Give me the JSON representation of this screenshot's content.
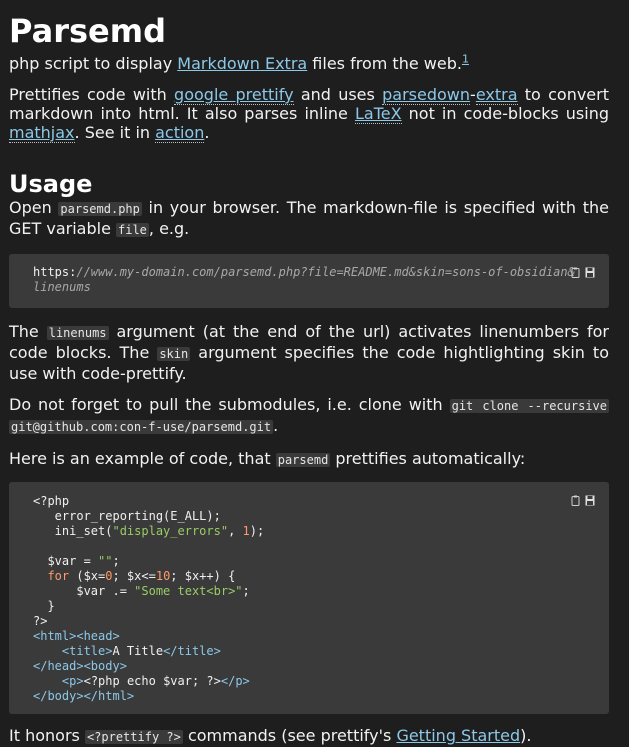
{
  "title": "Parsemd",
  "tagline": {
    "before": "php script to display ",
    "link": "Markdown Extra",
    "after": " files from the web.",
    "footnote": "1"
  },
  "pretty": {
    "t1": "Prettifies code with ",
    "l1": "google prettify",
    "t2": " and uses ",
    "l2": "parsedown",
    "dash": "-",
    "l3": "extra",
    "t3": " to convert markdown into html. It also parses inline ",
    "l4": "LaTeX",
    "t4": " not in code-blocks using ",
    "l5": "mathjax",
    "t5": ". See it in ",
    "l6": "action",
    "t6": "."
  },
  "usage_heading": "Usage",
  "open": {
    "t1": "Open ",
    "c1": "parsemd.php",
    "t2": " in your browser. The markdown-file is specified with the GET variable ",
    "c2": "file",
    "t3": ", e.g."
  },
  "url_block": {
    "scheme": "https:",
    "rest": "//www.my-domain.com/parsemd.php?file=README.md&skin=sons-of-obsidian&",
    "line2": "linenums"
  },
  "linenums_para": {
    "t1": "The ",
    "c1": "linenums",
    "t2": " argument (at the end of the url) activates linenumbers for code blocks. The ",
    "c2": "skin",
    "t3": " argument specifies the code hightlighting skin to use with code-prettify."
  },
  "submodule_para": {
    "t1": "Do not forget to pull the submodules, i.e. clone with ",
    "c1": "git clone --recursive",
    "c2": "git@github.com:con-f-use/parsemd.git",
    "t2": "."
  },
  "example_para": {
    "t1": "Here is an example of code, that ",
    "c1": "parsemd",
    "t2": " prettifies automatically:"
  },
  "code": {
    "l1": "<?php",
    "l2a": "   error_reporting(E_ALL);",
    "l3a": "   ini_set(",
    "l3s": "\"display_errors\"",
    "l3b": ", ",
    "l3n": "1",
    "l3c": ");",
    "l5a": "  $var = ",
    "l5s": "\"\"",
    "l5b": ";",
    "l6k": "  for",
    "l6a": " ($x=",
    "l6n1": "0",
    "l6b": "; $x<=",
    "l6n2": "10",
    "l6c": "; $x++) {",
    "l7a": "      $var .= ",
    "l7s": "\"Some text<br>\"",
    "l7b": ";",
    "l8": "  }",
    "l9": "?>",
    "l10t": "<html><head>",
    "l11a": "    ",
    "l11t1": "<title>",
    "l11txt": "A Title",
    "l11t2": "</title>",
    "l12t": "</head><body>",
    "l13a": "    ",
    "l13t1": "<p>",
    "l13txt": "<?php echo $var; ?>",
    "l13t2": "</p>",
    "l14t": "</body></html>"
  },
  "honors": {
    "t1": "It honors ",
    "c1": "<?prettify ?>",
    "t2": " commands (see prettify's ",
    "l1": "Getting Started",
    "t3": ")."
  },
  "icons": {
    "copy": "copy-icon",
    "save": "save-icon"
  },
  "colors": {
    "background": "#1e1e1e",
    "link": "#8cc8e8",
    "code_bg": "#3a3a3a",
    "keyword": "#ff9a6a",
    "string": "#99cc66",
    "tag": "#8cc8e8"
  }
}
